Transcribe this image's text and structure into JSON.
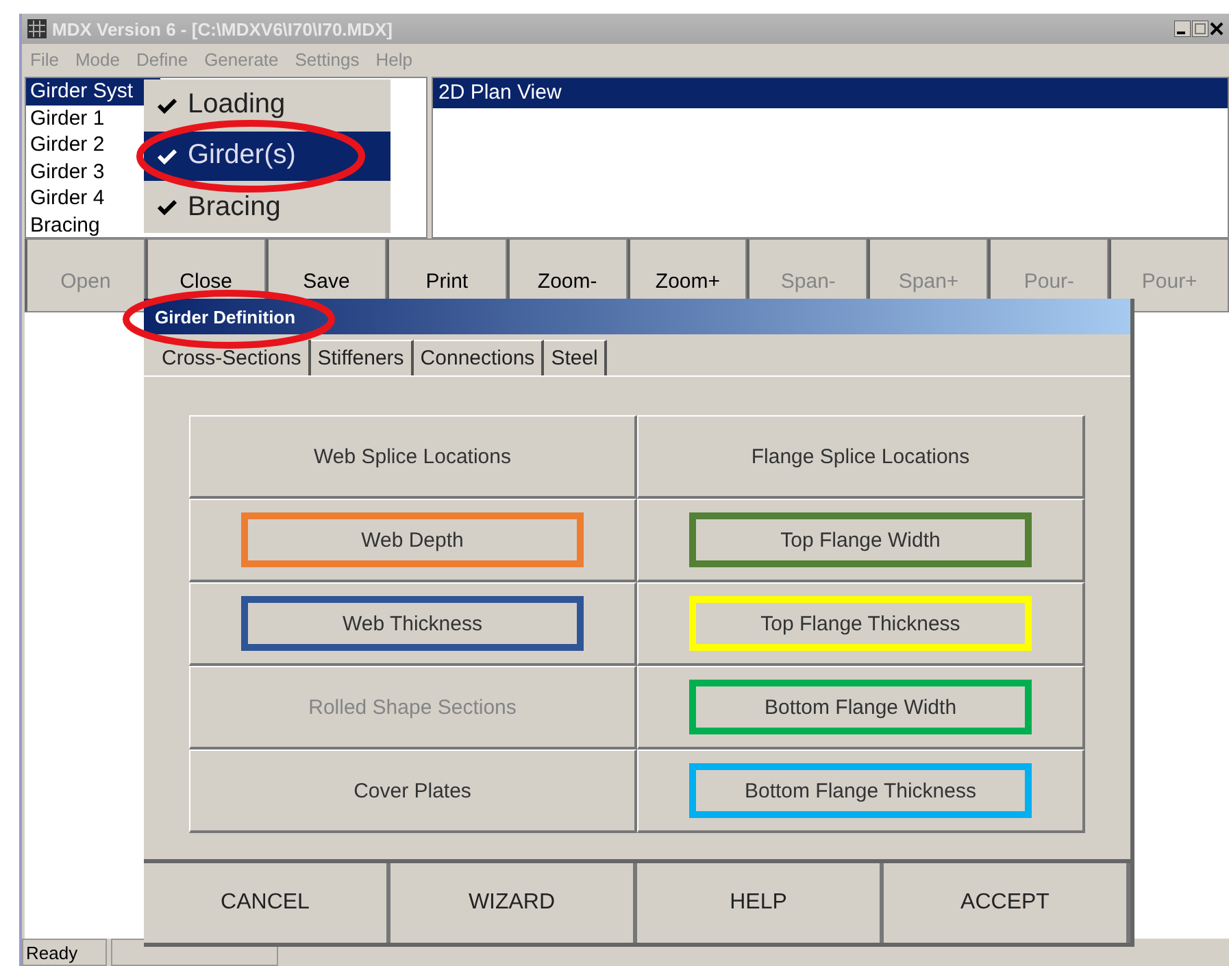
{
  "window": {
    "title": "MDX Version 6 - [C:\\MDXV6\\I70\\I70.MDX]"
  },
  "menu": [
    "File",
    "Mode",
    "Define",
    "Generate",
    "Settings",
    "Help"
  ],
  "tree_items": [
    {
      "label": "Girder Syst",
      "selected": true
    },
    {
      "label": "Girder 1",
      "selected": false
    },
    {
      "label": "Girder 2",
      "selected": false
    },
    {
      "label": "Girder 3",
      "selected": false
    },
    {
      "label": "Girder 4",
      "selected": false
    },
    {
      "label": "Bracing",
      "selected": false
    }
  ],
  "popup_menu": [
    {
      "label": "Loading",
      "checked": true,
      "selected": false,
      "circled": false
    },
    {
      "label": "Girder(s)",
      "checked": true,
      "selected": true,
      "circled": true
    },
    {
      "label": "Bracing",
      "checked": true,
      "selected": false,
      "circled": false
    }
  ],
  "view_panel": {
    "title": "2D Plan View"
  },
  "toolbar": [
    {
      "label": "Open",
      "disabled": true
    },
    {
      "label": "Close",
      "disabled": false
    },
    {
      "label": "Save",
      "disabled": false
    },
    {
      "label": "Print",
      "disabled": false
    },
    {
      "label": "Zoom-",
      "disabled": false
    },
    {
      "label": "Zoom+",
      "disabled": false
    },
    {
      "label": "Span-",
      "disabled": true
    },
    {
      "label": "Span+",
      "disabled": true
    },
    {
      "label": "Pour-",
      "disabled": true
    },
    {
      "label": "Pour+",
      "disabled": true
    }
  ],
  "dialog": {
    "title": "Girder Definition",
    "title_circled": true,
    "tabs": [
      {
        "label": "Cross-Sections",
        "selected": true
      },
      {
        "label": "Stiffeners",
        "selected": false
      },
      {
        "label": "Connections",
        "selected": false
      },
      {
        "label": "Steel",
        "selected": false
      }
    ],
    "grid": [
      {
        "label": "Web Splice Locations",
        "disabled": false
      },
      {
        "label": "Flange Splice Locations",
        "disabled": false
      },
      {
        "label": "Web Depth",
        "disabled": false,
        "color": "#ed7d31"
      },
      {
        "label": "Top Flange Width",
        "disabled": false,
        "color": "#538135"
      },
      {
        "label": "Web Thickness",
        "disabled": false,
        "color": "#2f5597"
      },
      {
        "label": "Top Flange Thickness",
        "disabled": false,
        "color": "#ffff00"
      },
      {
        "label": "Rolled Shape Sections",
        "disabled": true
      },
      {
        "label": "Bottom Flange Width",
        "disabled": false,
        "color": "#00b050"
      },
      {
        "label": "Cover Plates",
        "disabled": false
      },
      {
        "label": "Bottom Flange Thickness",
        "disabled": false,
        "color": "#00b0f0"
      }
    ],
    "buttons": [
      "CANCEL",
      "WIZARD",
      "HELP",
      "ACCEPT"
    ]
  },
  "status_bar": {
    "text": "Ready"
  }
}
